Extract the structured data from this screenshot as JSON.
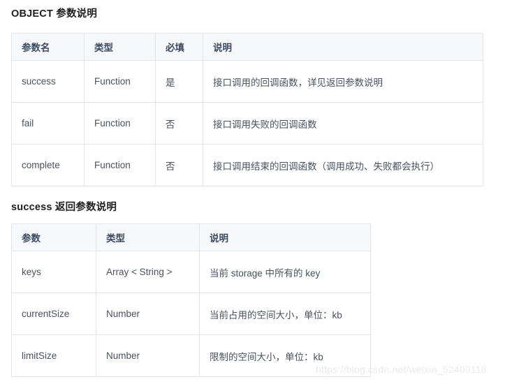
{
  "sections": [
    {
      "heading": "OBJECT 参数说明",
      "table": {
        "columns": [
          "参数名",
          "类型",
          "必填",
          "说明"
        ],
        "rows": [
          [
            "success",
            "Function",
            "是",
            "接口调用的回调函数，详见返回参数说明"
          ],
          [
            "fail",
            "Function",
            "否",
            "接口调用失败的回调函数"
          ],
          [
            "complete",
            "Function",
            "否",
            "接口调用结束的回调函数（调用成功、失败都会执行）"
          ]
        ]
      }
    },
    {
      "heading": "success 返回参数说明",
      "table": {
        "columns": [
          "参数",
          "类型",
          "说明"
        ],
        "rows": [
          [
            "keys",
            "Array < String >",
            "当前 storage 中所有的 key"
          ],
          [
            "currentSize",
            "Number",
            "当前占用的空间大小，单位：kb"
          ],
          [
            "limitSize",
            "Number",
            "限制的空间大小，单位：kb"
          ]
        ]
      }
    }
  ],
  "watermark": {
    "text": "https://blog.csdn.net/weixin_52400118"
  },
  "colors": {
    "header_bg": "#f7f8f9",
    "header_text": "#3b4a63",
    "body_text": "#4a5160",
    "border": "#e3e5e8",
    "heading_text": "#1f1f1f",
    "watermark_text": "#e8eaec"
  }
}
